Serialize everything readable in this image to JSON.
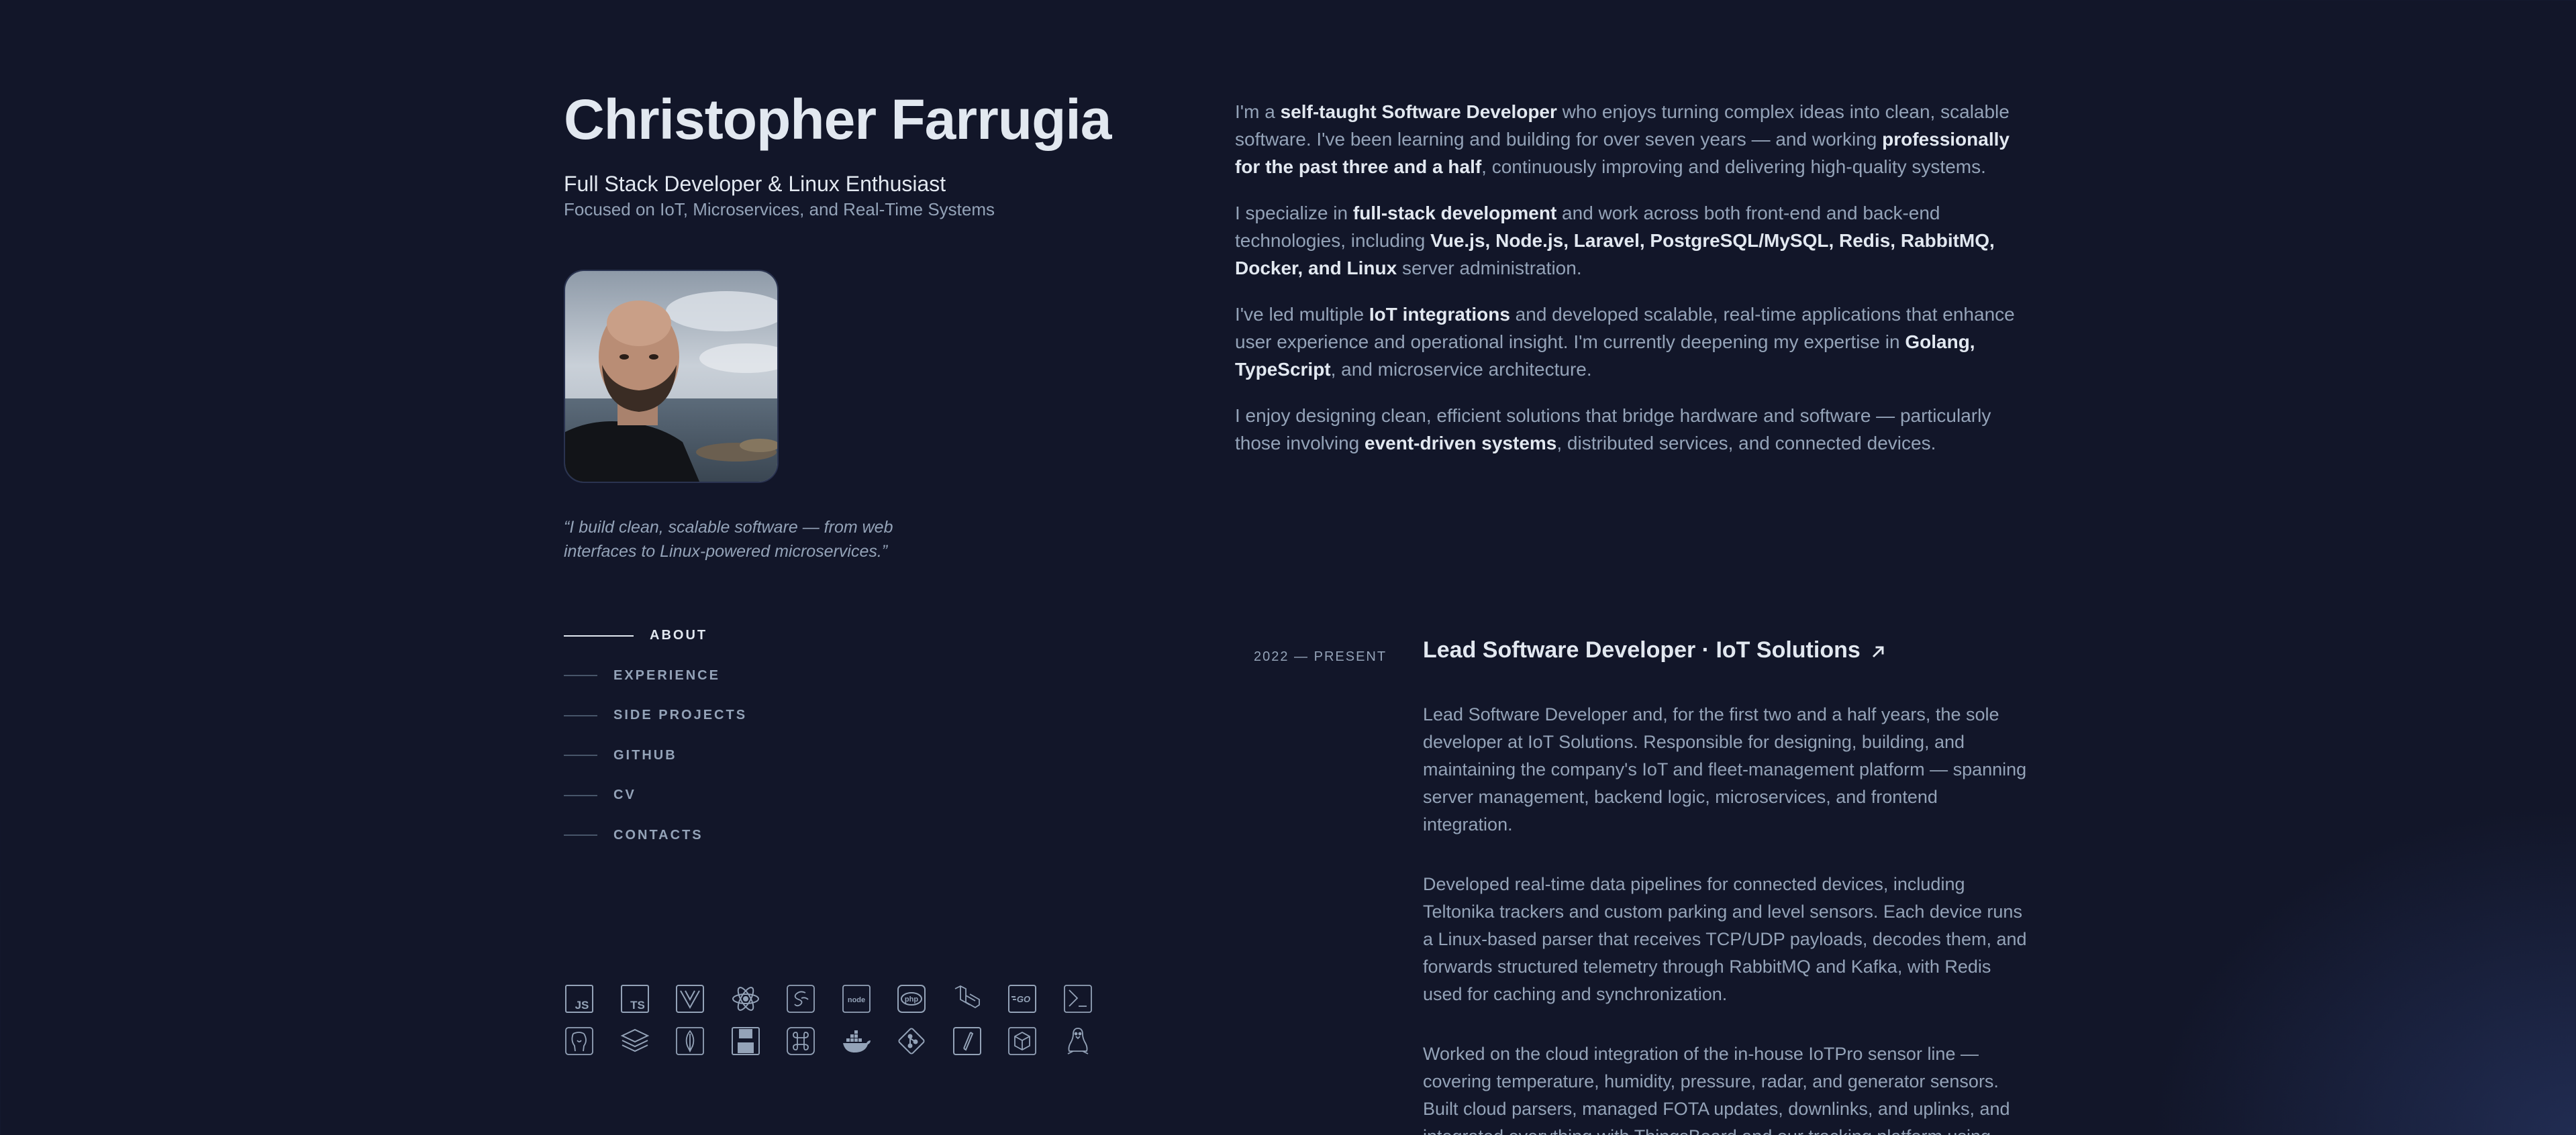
{
  "profile": {
    "name": "Christopher Farrugia",
    "role": "Full Stack Developer & Linux Enthusiast",
    "focus": "Focused on IoT, Microservices, and Real-Time Systems",
    "quote": "“I build clean, scalable software — from web interfaces to Linux-powered microservices.”"
  },
  "nav": {
    "items": [
      {
        "label": "ABOUT",
        "active": true
      },
      {
        "label": "EXPERIENCE",
        "active": false
      },
      {
        "label": "SIDE PROJECTS",
        "active": false
      },
      {
        "label": "GITHUB",
        "active": false
      },
      {
        "label": "CV",
        "active": false
      },
      {
        "label": "CONTACTS",
        "active": false
      }
    ]
  },
  "tech_icons": {
    "row1": [
      "javascript-icon",
      "typescript-icon",
      "vue-icon",
      "react-icon",
      "sass-icon",
      "nodejs-icon",
      "php-icon",
      "laravel-icon",
      "golang-icon",
      "bash-icon"
    ],
    "row2": [
      "postgresql-icon",
      "layers-stack-icon",
      "mongodb-icon",
      "save-disk-icon",
      "command-key-icon",
      "docker-icon",
      "git-icon",
      "pen-nib-icon",
      "cube-icon",
      "linux-tux-icon"
    ],
    "texts": {
      "js": "JS",
      "ts": "TS",
      "go": "GO",
      "php": "php",
      "node": "node"
    }
  },
  "about": {
    "p1": {
      "t1": "I'm a ",
      "b1": "self-taught Software Developer",
      "t2": " who enjoys turning complex ideas into clean, scalable software. I've been learning and building for over seven years — and working ",
      "b2": "professionally for the past three and a half",
      "t3": ", continuously improving and delivering high-quality systems."
    },
    "p2": {
      "t1": "I specialize in ",
      "b1": "full-stack development",
      "t2": " and work across both front-end and back-end technologies, including ",
      "b2": "Vue.js, Node.js, Laravel, PostgreSQL/MySQL, Redis, RabbitMQ, Docker, and Linux",
      "t3": " server administration."
    },
    "p3": {
      "t1": "I've led multiple ",
      "b1": "IoT integrations",
      "t2": " and developed scalable, real-time applications that enhance user experience and operational insight. I'm currently deepening my expertise in ",
      "b2": "Golang, TypeScript",
      "t3": ", and microservice architecture."
    },
    "p4": {
      "t1": "I enjoy designing clean, efficient solutions that bridge hardware and software — particularly those involving ",
      "b1": "event-driven systems",
      "t2": ", distributed services, and connected devices."
    }
  },
  "experience": [
    {
      "date": "2022 — PRESENT",
      "title": "Lead Software Developer · IoT Solutions",
      "paragraphs": [
        "Lead Software Developer and, for the first two and a half years, the sole developer at IoT Solutions. Responsible for designing, building, and maintaining the company's IoT and fleet-management platform — spanning server management, backend logic, microservices, and frontend integration.",
        "Developed real-time data pipelines for connected devices, including Teltonika trackers and custom parking and level sensors. Each device runs a Linux-based parser that receives TCP/UDP payloads, decodes them, and forwards structured telemetry through RabbitMQ and Kafka, with Redis used for caching and synchronization.",
        "Worked on the cloud integration of the in-house IoTPro sensor line — covering temperature, humidity, pressure, radar, and generator sensors. Built cloud parsers, managed FOTA updates, downlinks, and uplinks, and integrated everything with ThingsBoard and our tracking platform using"
      ]
    }
  ],
  "colors": {
    "background": "#121629",
    "text_primary": "#e2e8f0",
    "text_secondary": "#94a3b8",
    "line_inactive": "#475569"
  }
}
